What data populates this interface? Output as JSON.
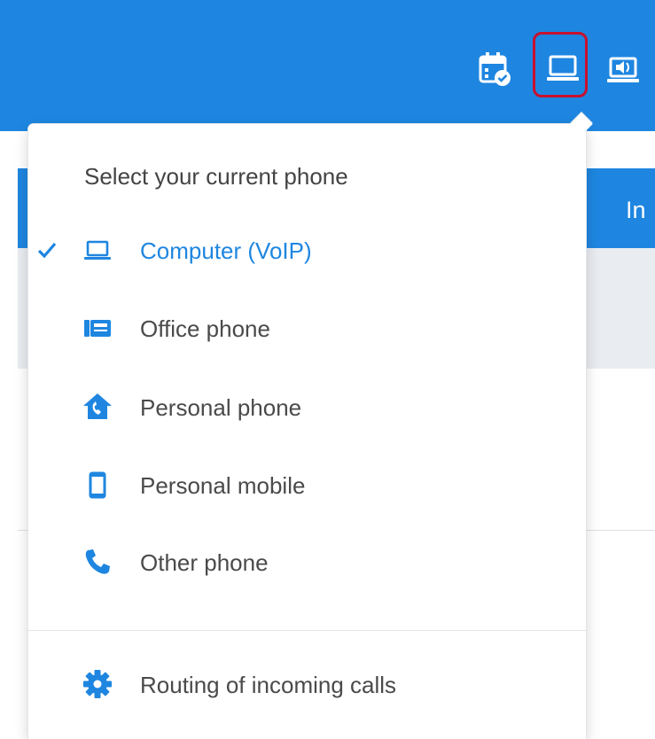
{
  "colors": {
    "primary": "#1e86e0",
    "highlight": "#c8102e",
    "text": "#4a4a4a"
  },
  "topbar": {
    "icons": [
      "calendar-check-icon",
      "computer-voip-icon",
      "speaker-icon"
    ]
  },
  "background": {
    "band_text": "In"
  },
  "phone_menu": {
    "header": "Select your current phone",
    "items": [
      {
        "label": "Computer (VoIP)",
        "icon": "laptop-icon",
        "selected": true
      },
      {
        "label": "Office phone",
        "icon": "office-phone-icon",
        "selected": false
      },
      {
        "label": "Personal phone",
        "icon": "home-phone-icon",
        "selected": false
      },
      {
        "label": "Personal mobile",
        "icon": "mobile-icon",
        "selected": false
      },
      {
        "label": "Other phone",
        "icon": "phone-handset-icon",
        "selected": false
      }
    ],
    "routing": {
      "label": "Routing of incoming calls",
      "icon": "gear-icon"
    }
  }
}
